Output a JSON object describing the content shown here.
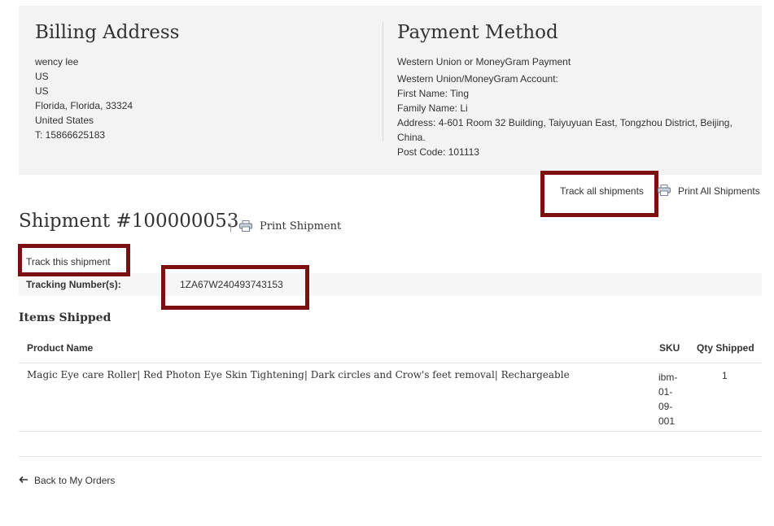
{
  "billing": {
    "title": "Billing Address",
    "lines": [
      "wency lee",
      "US",
      "US",
      "Florida, Florida, 33324",
      "United States",
      "T: 15866625183"
    ]
  },
  "payment": {
    "title": "Payment Method",
    "method": "Western Union or MoneyGram Payment",
    "account_label": "Western Union/MoneyGram Account:",
    "first_name": "First Name: Ting",
    "family_name": "Family Name: Li",
    "address_line1": "Address: 4-601 Room 32 Building, Taiyuyuan East, Tongzhou District, Beijing,",
    "address_line2": "China.",
    "post_code": "Post Code: 101113"
  },
  "actions": {
    "track_all": "Track all shipments",
    "print_all": "Print All Shipments"
  },
  "shipment": {
    "title": "Shipment #100000053",
    "separator": "|",
    "print_label": "Print Shipment",
    "track_label": "Track this shipment",
    "tracking_label": "Tracking Number(s):",
    "tracking_number": "1ZA67W240493743153"
  },
  "items": {
    "title": "Items Shipped",
    "headers": {
      "product": "Product Name",
      "sku": "SKU",
      "qty": "Qty Shipped"
    },
    "rows": [
      {
        "product": "Magic Eye care Roller| Red Photon Eye Skin Tightening| Dark circles and Crow's feet removal| Rechargeable",
        "sku_lines": [
          "ibm-",
          "01-",
          "09-",
          "001"
        ],
        "qty": "1"
      }
    ]
  },
  "footer": {
    "back_label": "Back to My Orders"
  },
  "colors": {
    "highlight": "#7c1010",
    "panel_bg": "#f3f3f3",
    "text": "#333333"
  },
  "icons": [
    "printer-icon",
    "arrow-left-icon"
  ]
}
